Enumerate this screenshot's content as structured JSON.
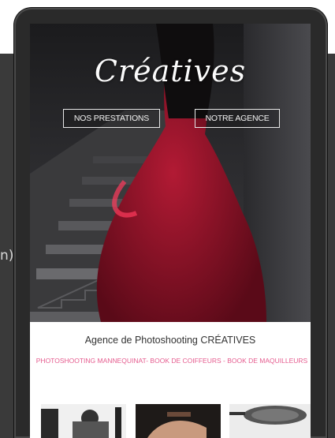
{
  "backdrop": {
    "fragment_text": "n)"
  },
  "hero": {
    "logo_text": "Créatives",
    "buttons": {
      "prestations": "NOS PRESTATIONS",
      "agence": "NOTRE AGENCE"
    }
  },
  "content": {
    "title": "Agence de Photoshooting CRÉATIVES",
    "subtitle": "PHOTOSHOOTING MANNEQUINAT- BOOK DE COIFFEURS - BOOK DE MAQUILLEURS"
  },
  "colors": {
    "accent_pink": "#e55b8e",
    "dress_red": "#8a1024"
  },
  "icons": {
    "thumbs": [
      "photo-studio-thumbnail",
      "makeup-thumbnail",
      "pan-thumbnail"
    ]
  }
}
